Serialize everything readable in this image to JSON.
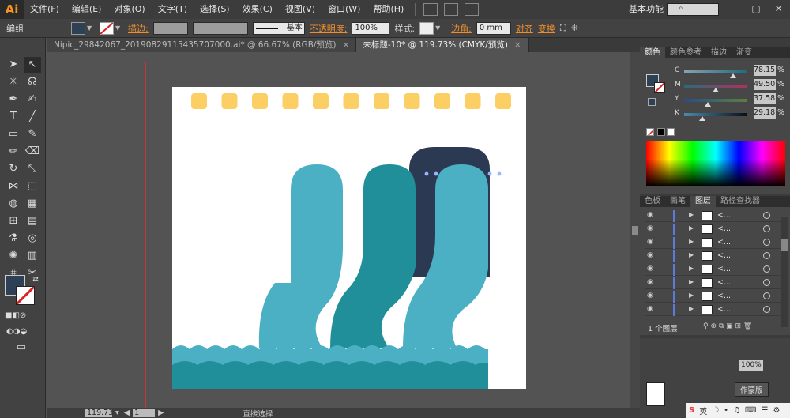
{
  "app": {
    "logo": "Ai",
    "menus": [
      "文件(F)",
      "编辑(E)",
      "对象(O)",
      "文字(T)",
      "选择(S)",
      "效果(C)",
      "视图(V)",
      "窗口(W)",
      "帮助(H)"
    ],
    "workspace": "基本功能",
    "window_controls": [
      "—",
      "▢",
      "✕"
    ]
  },
  "control_bar": {
    "mode_label": "编组",
    "stroke_label": "描边:",
    "brush_label": "基本",
    "opacity_label": "不透明度:",
    "opacity_value": "100%",
    "style_label": "样式:",
    "corner_label": "边角:",
    "corner_value": "0 mm",
    "align_label": "对齐",
    "transform_label": "变换",
    "fill_color": "#2d4056",
    "orange": "#f08c2c"
  },
  "tabs": [
    {
      "label": "Nipic_29842067_20190829115435707000.ai* @ 66.67% (RGB/预览)",
      "close": "×",
      "active": false
    },
    {
      "label": "未标题-10* @ 119.73% (CMYK/预览)",
      "close": "×",
      "active": true
    }
  ],
  "status_bar": {
    "zoom": "119.73",
    "page": "1",
    "status": "直接选择"
  },
  "color_panel": {
    "tabs": [
      "颜色",
      "颜色参考",
      "描边",
      "渐变"
    ],
    "channels": [
      {
        "letter": "C",
        "value": "78.15",
        "fraction": 0.78
      },
      {
        "letter": "M",
        "value": "49.50",
        "fraction": 0.495
      },
      {
        "letter": "Y",
        "value": "37.58",
        "fraction": 0.376
      },
      {
        "letter": "K",
        "value": "29.18",
        "fraction": 0.292
      }
    ],
    "pct": "%",
    "fill_color": "#2d4056"
  },
  "layers_panel": {
    "tabs": [
      "色板",
      "画笔",
      "图层",
      "路径查找器"
    ],
    "rows": [
      "<...",
      "<...",
      "<...",
      "<...",
      "<...",
      "<...",
      "<...",
      "<..."
    ],
    "footer": "1 个图层"
  },
  "artwork": {
    "dot_color": "#fbcf64",
    "pillar_light": "#4bb0c4",
    "pillar_dark": "#218f99",
    "pillar_navy": "#2b3a52",
    "wave_color": "#4bb0c4",
    "wave_dark": "#218f99"
  },
  "taskbar": {
    "items": [
      "S",
      "英",
      "☽",
      "•",
      "♫",
      "⌨",
      "☰",
      "⚙"
    ],
    "tooltip": "作蒙版"
  }
}
